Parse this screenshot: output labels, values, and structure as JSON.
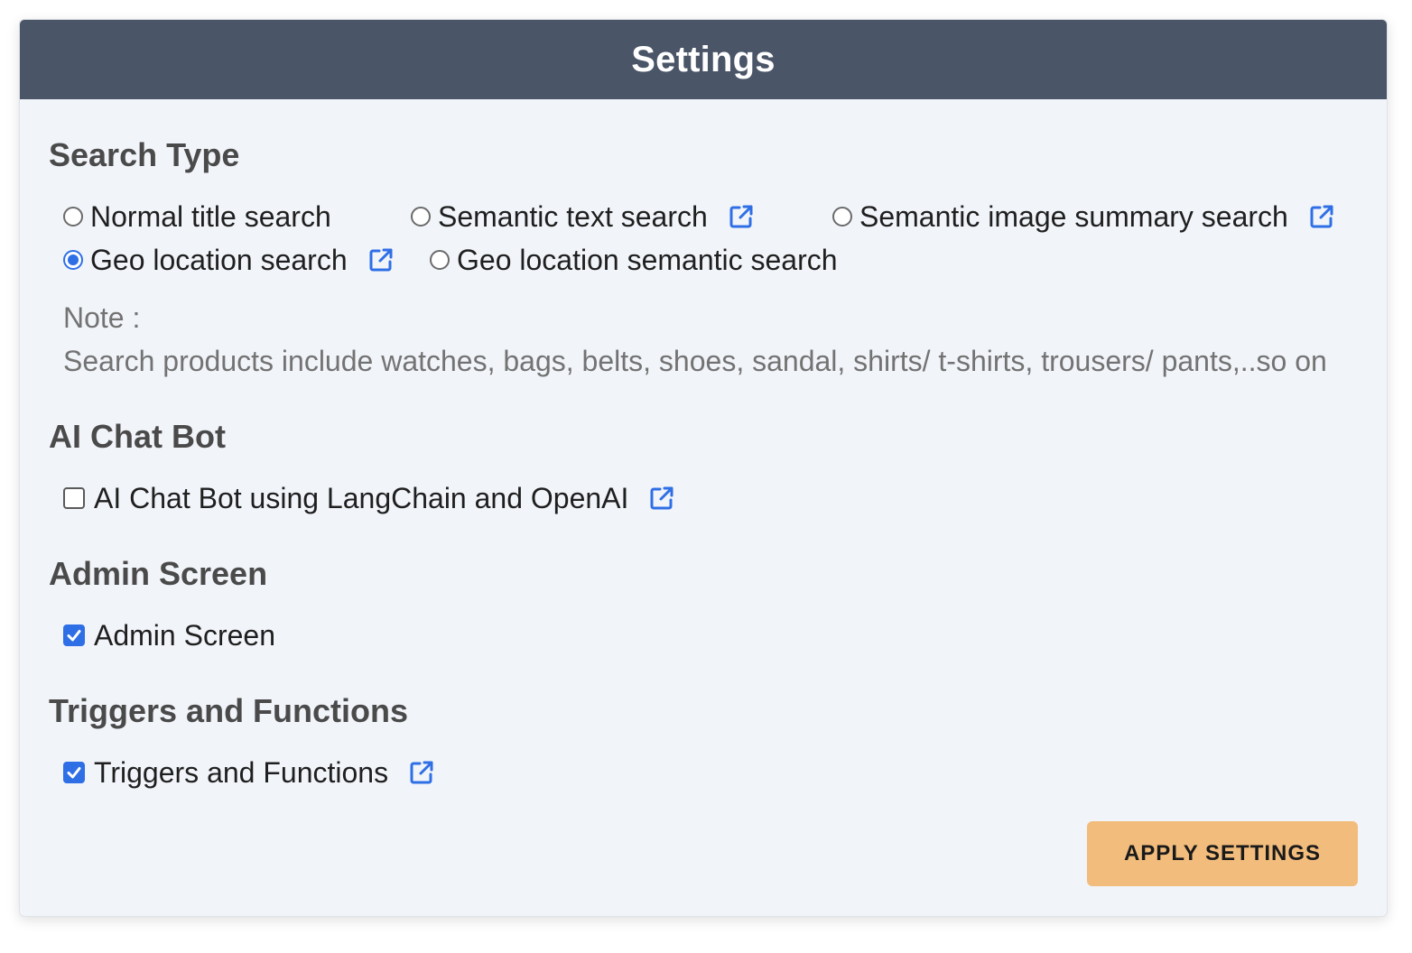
{
  "header": {
    "title": "Settings"
  },
  "search_type": {
    "title": "Search Type",
    "options": [
      {
        "label": "Normal title search",
        "selected": false,
        "has_link": false
      },
      {
        "label": "Semantic text search",
        "selected": false,
        "has_link": true
      },
      {
        "label": "Semantic image summary search",
        "selected": false,
        "has_link": true
      },
      {
        "label": "Geo location search",
        "selected": true,
        "has_link": true
      },
      {
        "label": "Geo location semantic search",
        "selected": false,
        "has_link": false
      }
    ],
    "note_label": "Note :",
    "note_text": "Search products include watches, bags, belts, shoes, sandal, shirts/ t-shirts, trousers/ pants,..so on"
  },
  "ai_chat_bot": {
    "title": "AI Chat Bot",
    "option_label": "AI Chat Bot using LangChain and OpenAI",
    "checked": false
  },
  "admin_screen": {
    "title": "Admin Screen",
    "option_label": "Admin Screen",
    "checked": true
  },
  "triggers": {
    "title": "Triggers and Functions",
    "option_label": "Triggers and Functions",
    "checked": true
  },
  "apply_button": {
    "label": "APPLY SETTINGS"
  },
  "colors": {
    "header_bg": "#4a5568",
    "panel_bg": "#f1f4f9",
    "accent_blue": "#2f6fe6",
    "button_bg": "#f2bc7c"
  },
  "icons": {
    "external_link": "external-link-icon",
    "checkmark": "checkmark-icon"
  }
}
